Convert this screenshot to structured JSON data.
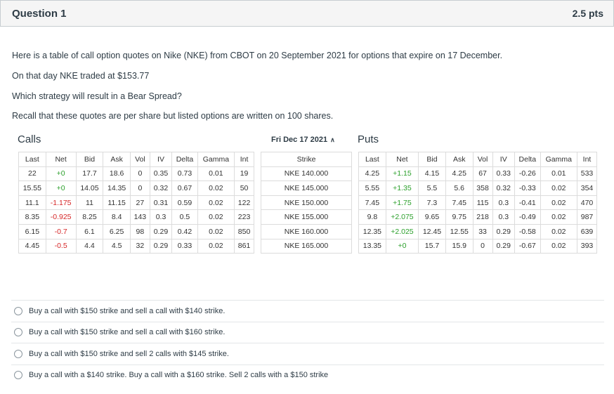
{
  "question": {
    "title": "Question 1",
    "points": "2.5 pts",
    "paragraphs": [
      "Here is a table of call option quotes on Nike (NKE) from CBOT on 20 September 2021 for options that expire on 17 December.",
      "On that day NKE traded at $153.77",
      "Which strategy will result in a Bear Spread?",
      "Recall that these quotes are per share but listed options are written on 100 shares."
    ]
  },
  "quotes": {
    "calls_label": "Calls",
    "puts_label": "Puts",
    "expiry_label": "Fri Dec 17 2021",
    "calls_headers": [
      "Last",
      "Net",
      "Bid",
      "Ask",
      "Vol",
      "IV",
      "Delta",
      "Gamma",
      "Int"
    ],
    "calls_rows": [
      [
        "22",
        "+0",
        "17.7",
        "18.6",
        "0",
        "0.35",
        "0.73",
        "0.01",
        "19"
      ],
      [
        "15.55",
        "+0",
        "14.05",
        "14.35",
        "0",
        "0.32",
        "0.67",
        "0.02",
        "50"
      ],
      [
        "11.1",
        "-1.175",
        "11",
        "11.15",
        "27",
        "0.31",
        "0.59",
        "0.02",
        "122"
      ],
      [
        "8.35",
        "-0.925",
        "8.25",
        "8.4",
        "143",
        "0.3",
        "0.5",
        "0.02",
        "223"
      ],
      [
        "6.15",
        "-0.7",
        "6.1",
        "6.25",
        "98",
        "0.29",
        "0.42",
        "0.02",
        "850"
      ],
      [
        "4.45",
        "-0.5",
        "4.4",
        "4.5",
        "32",
        "0.29",
        "0.33",
        "0.02",
        "861"
      ]
    ],
    "strike_header": "Strike",
    "strikes": [
      "NKE 140.000",
      "NKE 145.000",
      "NKE 150.000",
      "NKE 155.000",
      "NKE 160.000",
      "NKE 165.000"
    ],
    "puts_headers": [
      "Last",
      "Net",
      "Bid",
      "Ask",
      "Vol",
      "IV",
      "Delta",
      "Gamma",
      "Int"
    ],
    "puts_rows": [
      [
        "4.25",
        "+1.15",
        "4.15",
        "4.25",
        "67",
        "0.33",
        "-0.26",
        "0.01",
        "533"
      ],
      [
        "5.55",
        "+1.35",
        "5.5",
        "5.6",
        "358",
        "0.32",
        "-0.33",
        "0.02",
        "354"
      ],
      [
        "7.45",
        "+1.75",
        "7.3",
        "7.45",
        "115",
        "0.3",
        "-0.41",
        "0.02",
        "470"
      ],
      [
        "9.8",
        "+2.075",
        "9.65",
        "9.75",
        "218",
        "0.3",
        "-0.49",
        "0.02",
        "987"
      ],
      [
        "12.35",
        "+2.025",
        "12.45",
        "12.55",
        "33",
        "0.29",
        "-0.58",
        "0.02",
        "639"
      ],
      [
        "13.35",
        "+0",
        "15.7",
        "15.9",
        "0",
        "0.29",
        "-0.67",
        "0.02",
        "393"
      ]
    ],
    "colors": {
      "positive": "#2ca02c",
      "negative": "#d62728"
    }
  },
  "answers": [
    "Buy a call with $150 strike and sell a call with $140 strike.",
    "Buy a call with $150 strike and sell a call with $160 strike.",
    "Buy a call with $150 strike and sell 2 calls with $145 strike.",
    "Buy a call with a $140 strike. Buy a call with a $160 strike. Sell 2 calls with a $150 strike"
  ]
}
